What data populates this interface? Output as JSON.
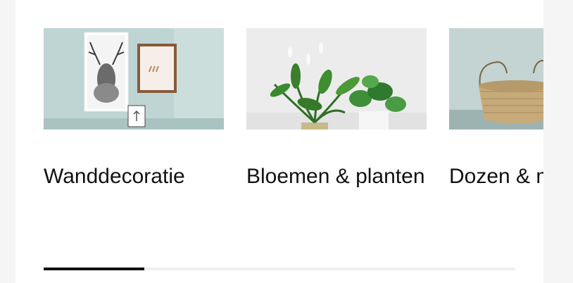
{
  "categories": [
    {
      "label": "Wanddecoratie",
      "image_icon": "wall-decoration-image"
    },
    {
      "label": "Bloemen & planten",
      "image_icon": "plants-image"
    },
    {
      "label": "Dozen & manden",
      "image_icon": "basket-image"
    }
  ],
  "scroll": {
    "position_fraction": 0.21
  },
  "colors": {
    "text": "#111111",
    "track": "#efefef",
    "thumb": "#111111"
  }
}
